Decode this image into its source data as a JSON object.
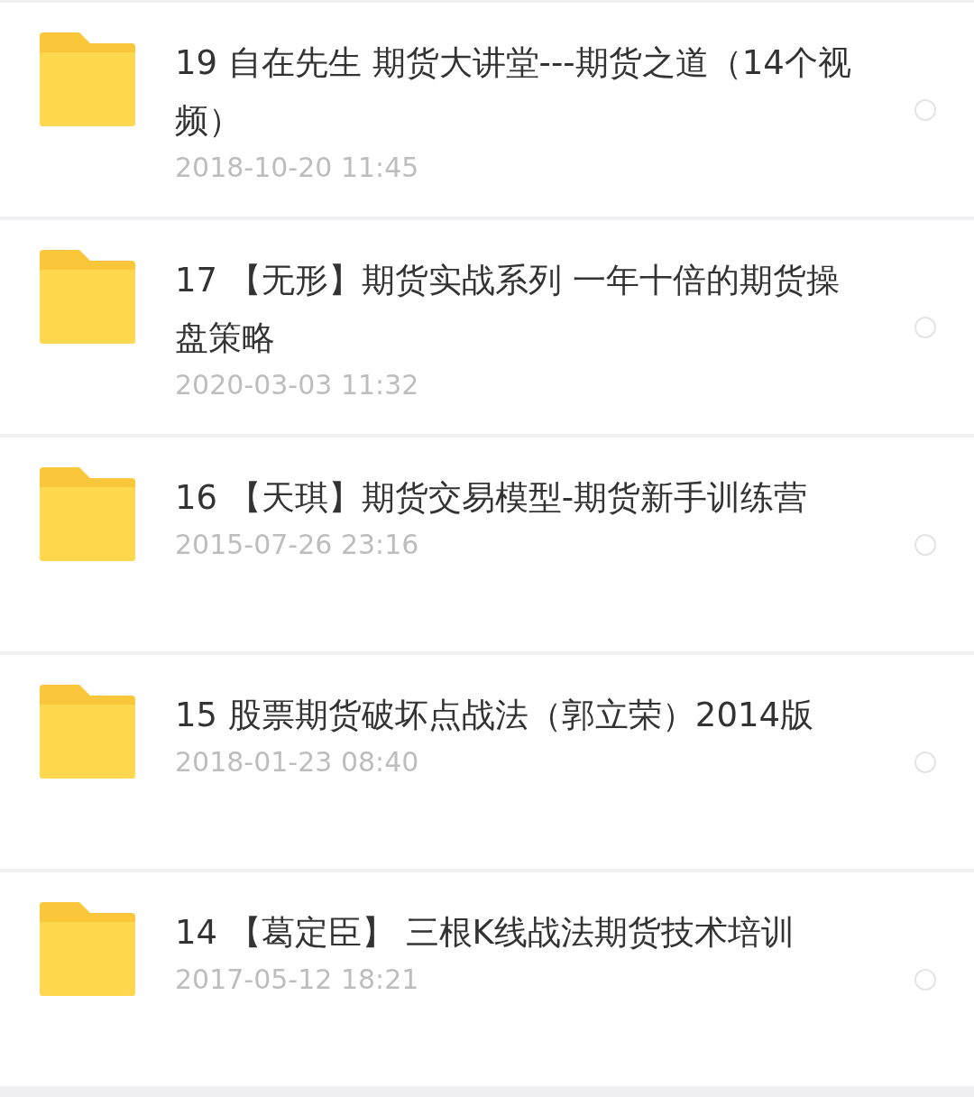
{
  "files": [
    {
      "name": "19 自在先生 期货大讲堂---期货之道（14个视频）",
      "date": "2018-10-20  11:45",
      "selected": false
    },
    {
      "name": "17 【无形】期货实战系列 一年十倍的期货操盘策略",
      "date": "2020-03-03  11:32",
      "selected": false
    },
    {
      "name": "16 【天琪】期货交易模型-期货新手训练营",
      "date": "2015-07-26  23:16",
      "selected": false
    },
    {
      "name": "15 股票期货破坏点战法（郭立荣）2014版",
      "date": "2018-01-23  08:40",
      "selected": false
    },
    {
      "name": "14 【葛定臣】 三根K线战法期货技术培训",
      "date": "2017-05-12  18:21",
      "selected": false
    }
  ]
}
